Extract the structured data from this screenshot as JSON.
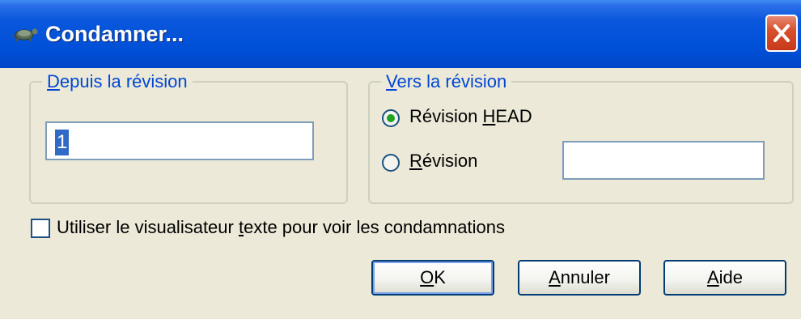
{
  "window": {
    "title": "Condamner...",
    "icon": "tortoise-icon"
  },
  "from_group": {
    "label_mnemonic": "D",
    "label_rest": "epuis la révision",
    "value": "1"
  },
  "to_group": {
    "label_mnemonic": "V",
    "label_rest": "ers la révision",
    "head_radio": {
      "label_pre": "Révision ",
      "label_mnemonic": "H",
      "label_post": "EAD",
      "checked": true
    },
    "revision_radio": {
      "label_mnemonic": "R",
      "label_post": "évision",
      "checked": false,
      "value": ""
    }
  },
  "text_viewer_checkbox": {
    "label_pre": "Utiliser le visualisateur ",
    "label_mnemonic": "t",
    "label_post": "exte pour voir les condamnations",
    "checked": false
  },
  "buttons": {
    "ok": {
      "mnemonic": "O",
      "rest": "K"
    },
    "cancel": {
      "mnemonic": "A",
      "rest": "nnuler"
    },
    "help": {
      "mnemonic": "A",
      "rest": "ide"
    }
  },
  "colors": {
    "titlebar": "#0050d8",
    "dialog_bg": "#ece9d8",
    "group_label": "#0046d5",
    "radio_dot": "#21a121",
    "close_button": "#d9512d"
  }
}
